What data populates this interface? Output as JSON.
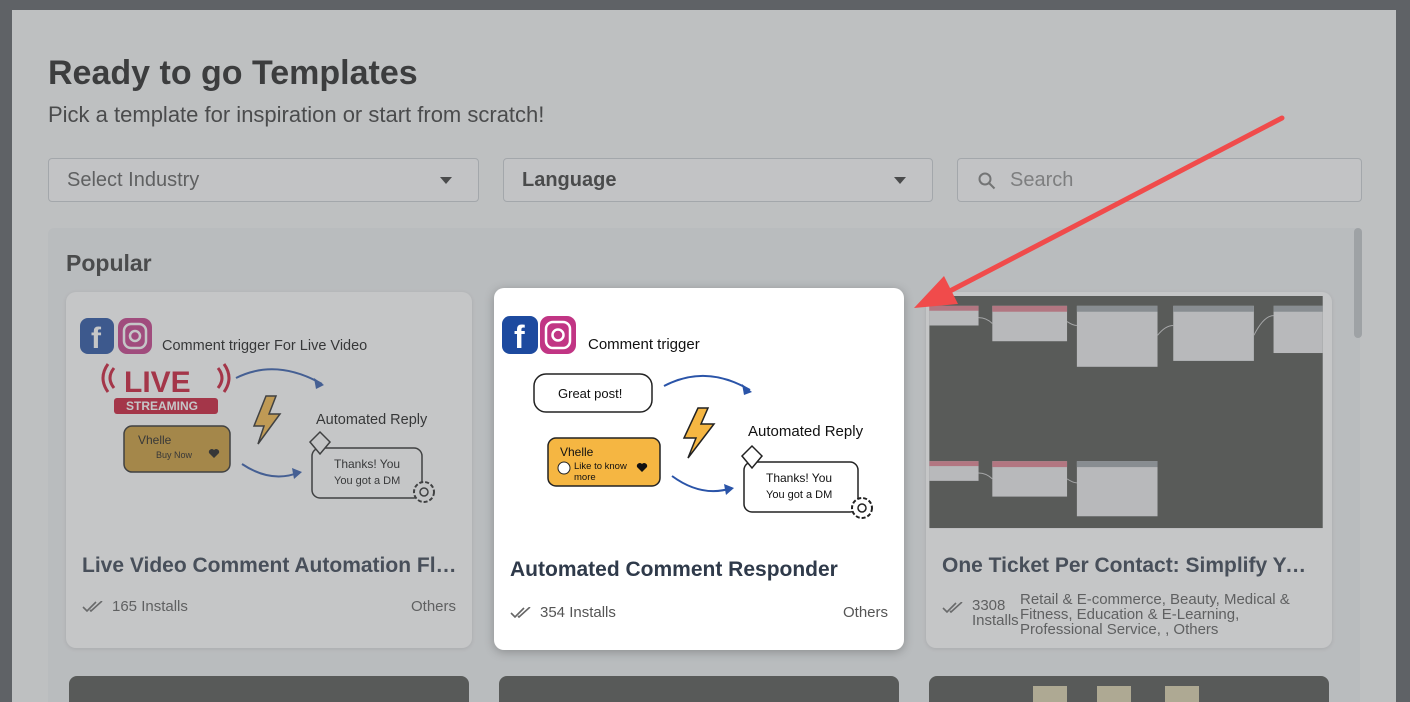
{
  "header": {
    "title": "Ready to go Templates",
    "subtitle": "Pick a template for inspiration or start from scratch!"
  },
  "filters": {
    "industry_placeholder": "Select Industry",
    "language_label": "Language",
    "search_placeholder": "Search"
  },
  "section": {
    "label": "Popular"
  },
  "cards": [
    {
      "title": "Live Video Comment Automation Flow",
      "installs": "165 Installs",
      "category": "Others",
      "thumb": {
        "trigger": "Comment trigger For Live Video",
        "live": "LIVE",
        "streaming": "STREAMING",
        "reply": "Automated Reply",
        "user": "Vhelle",
        "user_msg": "Buy Now",
        "dm1": "Thanks! You",
        "dm2": "You got a DM"
      }
    },
    {
      "title": "Automated Comment Responder",
      "installs": "354 Installs",
      "category": "Others",
      "thumb": {
        "trigger": "Comment trigger",
        "bubble": "Great post!",
        "reply": "Automated Reply",
        "user": "Vhelle",
        "user_msg1": "Like to know",
        "user_msg2": "more",
        "dm1": "Thanks! You",
        "dm2": "You got a DM"
      }
    },
    {
      "title": "One Ticket Per Contact: Simplify You...",
      "installs_num": "3308",
      "installs_label": "Installs",
      "category_lines": [
        "Retail & E-commerce, Beauty, Medical &",
        "Fitness, Education & E-Learning,",
        "Professional Service, , Others"
      ]
    }
  ],
  "colors": {
    "overlay": "#5f6266",
    "live_red": "#c8102e",
    "gold": "#f5b642",
    "arrow_red": "#f04b4b",
    "flow_bg": "#4b4d49"
  }
}
